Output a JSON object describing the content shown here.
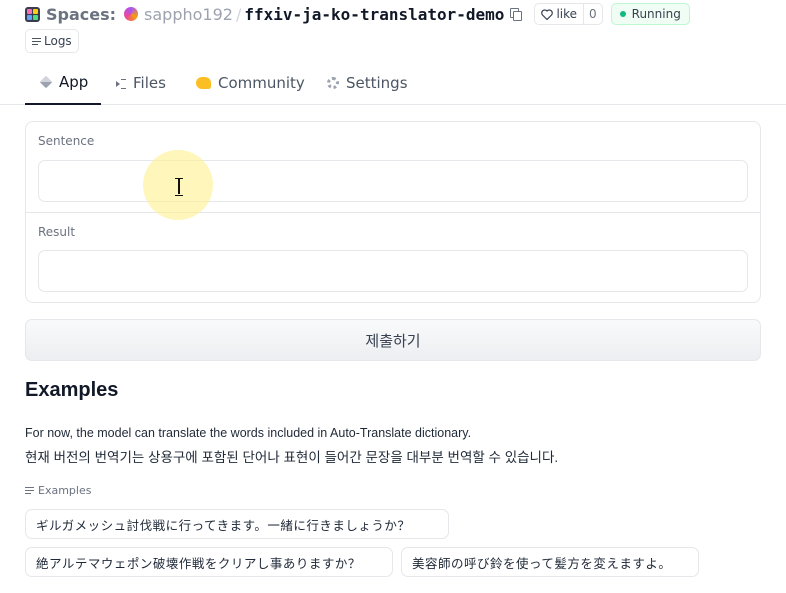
{
  "header": {
    "spaces_label": "Spaces:",
    "owner": "sappho192",
    "separator": "/",
    "repo": "ffxiv-ja-ko-translator-demo",
    "like_label": "like",
    "like_count": "0",
    "status": "Running",
    "logs_label": "Logs"
  },
  "tabs": [
    {
      "label": "App",
      "icon": "cube-icon"
    },
    {
      "label": "Files",
      "icon": "files-icon"
    },
    {
      "label": "Community",
      "icon": "community-icon"
    },
    {
      "label": "Settings",
      "icon": "gear-icon"
    }
  ],
  "form": {
    "sentence_label": "Sentence",
    "sentence_value": "",
    "result_label": "Result",
    "result_value": "",
    "submit_label": "제출하기"
  },
  "examples": {
    "heading": "Examples",
    "description_en": "For now, the model can translate the words included in Auto-Translate dictionary.",
    "description_ko": "현재 버전의 번역기는 상용구에 포함된 단어나 표현이 들어간 문장을 대부분 번역할 수 있습니다.",
    "label": "Examples",
    "items": [
      "ギルガメッシュ討伐戦に行ってきます。一緒に行きましょうか？",
      "絶アルテマウェポン破壊作戦をクリアし事ありますか？",
      "美容師の呼び鈴を使って髪方を変えますよ。"
    ]
  },
  "colors": {
    "status_accent": "#10b981",
    "community_accent": "#fbbf24"
  }
}
